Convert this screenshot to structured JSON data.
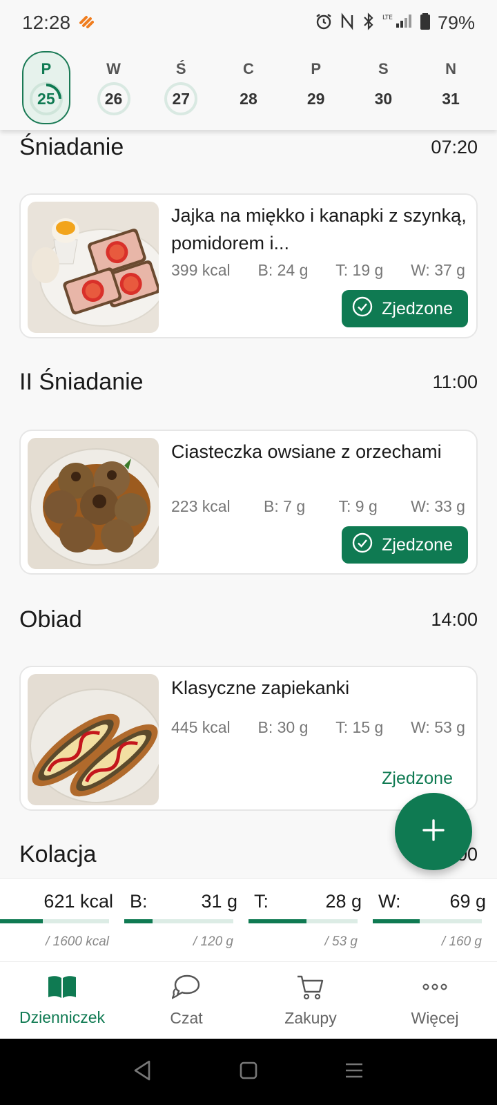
{
  "status_bar": {
    "time": "12:28",
    "battery": "79%"
  },
  "week": [
    {
      "letter": "P",
      "num": "25",
      "state": "active"
    },
    {
      "letter": "W",
      "num": "26",
      "state": "ring"
    },
    {
      "letter": "Ś",
      "num": "27",
      "state": "ring"
    },
    {
      "letter": "C",
      "num": "28",
      "state": ""
    },
    {
      "letter": "P",
      "num": "29",
      "state": ""
    },
    {
      "letter": "S",
      "num": "30",
      "state": ""
    },
    {
      "letter": "N",
      "num": "31",
      "state": ""
    }
  ],
  "meals": [
    {
      "title": "Śniadanie",
      "time": "07:20",
      "name": "Jajka na miękko i kanapki z szynką, pomidorem i...",
      "kcal": "399 kcal",
      "b": "B: 24 g",
      "t": "T: 19 g",
      "w": "W: 37 g",
      "eaten_label": "Zjedzone",
      "eaten": true
    },
    {
      "title": "II Śniadanie",
      "time": "11:00",
      "name": "Ciasteczka owsiane z orzechami",
      "kcal": "223 kcal",
      "b": "B: 7 g",
      "t": "T: 9 g",
      "w": "W: 33 g",
      "eaten_label": "Zjedzone",
      "eaten": true
    },
    {
      "title": "Obiad",
      "time": "14:00",
      "name": "Klasyczne zapiekanki",
      "kcal": "445 kcal",
      "b": "B: 30 g",
      "t": "T: 15 g",
      "w": "W: 53 g",
      "eaten_label": "Zjedzone",
      "eaten": false
    },
    {
      "title": "Kolacja",
      "time": "18:00"
    }
  ],
  "summary": [
    {
      "label": "",
      "value": "621 kcal",
      "goal": "/ 1600 kcal",
      "progress": 0.39
    },
    {
      "label": "B:",
      "value": "31 g",
      "goal": "/ 120 g",
      "progress": 0.26
    },
    {
      "label": "T:",
      "value": "28 g",
      "goal": "/ 53 g",
      "progress": 0.53
    },
    {
      "label": "W:",
      "value": "69 g",
      "goal": "/ 160 g",
      "progress": 0.43
    }
  ],
  "nav": [
    {
      "label": "Dzienniczek",
      "icon": "book-icon",
      "active": true
    },
    {
      "label": "Czat",
      "icon": "chat-icon",
      "active": false
    },
    {
      "label": "Zakupy",
      "icon": "cart-icon",
      "active": false
    },
    {
      "label": "Więcej",
      "icon": "more-icon",
      "active": false
    }
  ],
  "colors": {
    "accent": "#0f7a52",
    "accent_light": "#dcece5"
  }
}
